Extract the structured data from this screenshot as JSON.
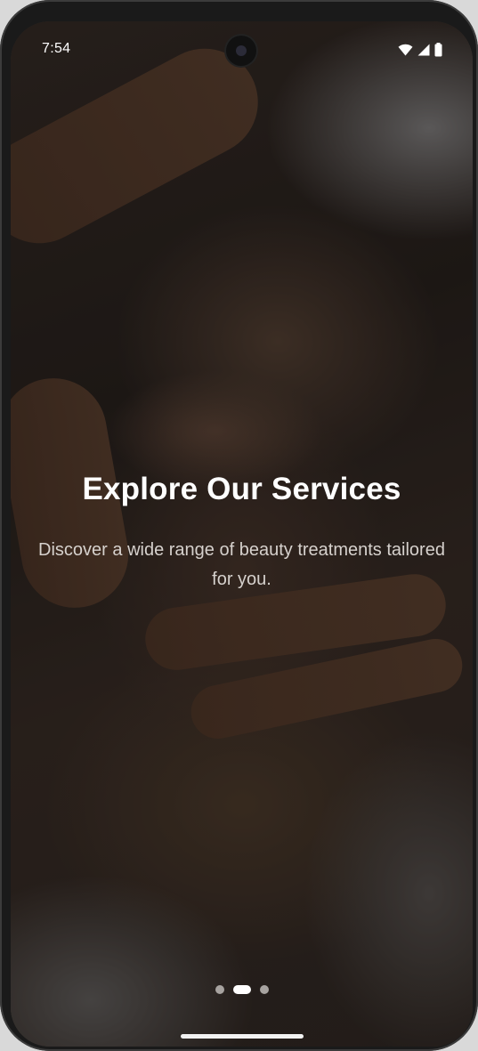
{
  "status_bar": {
    "time": "7:54",
    "icons": [
      "wifi-icon",
      "cellular-signal-icon",
      "battery-icon"
    ]
  },
  "onboarding": {
    "title": "Explore Our Services",
    "subtitle": "Discover a wide range of beauty treatments tailored for you.",
    "page_indicator": {
      "total_pages": 3,
      "current_page": 2
    }
  },
  "colors": {
    "title_text": "#ffffff",
    "subtitle_text": "#d6d1cd",
    "dot_active": "#ffffff",
    "dot_inactive": "#a7a3a0"
  }
}
